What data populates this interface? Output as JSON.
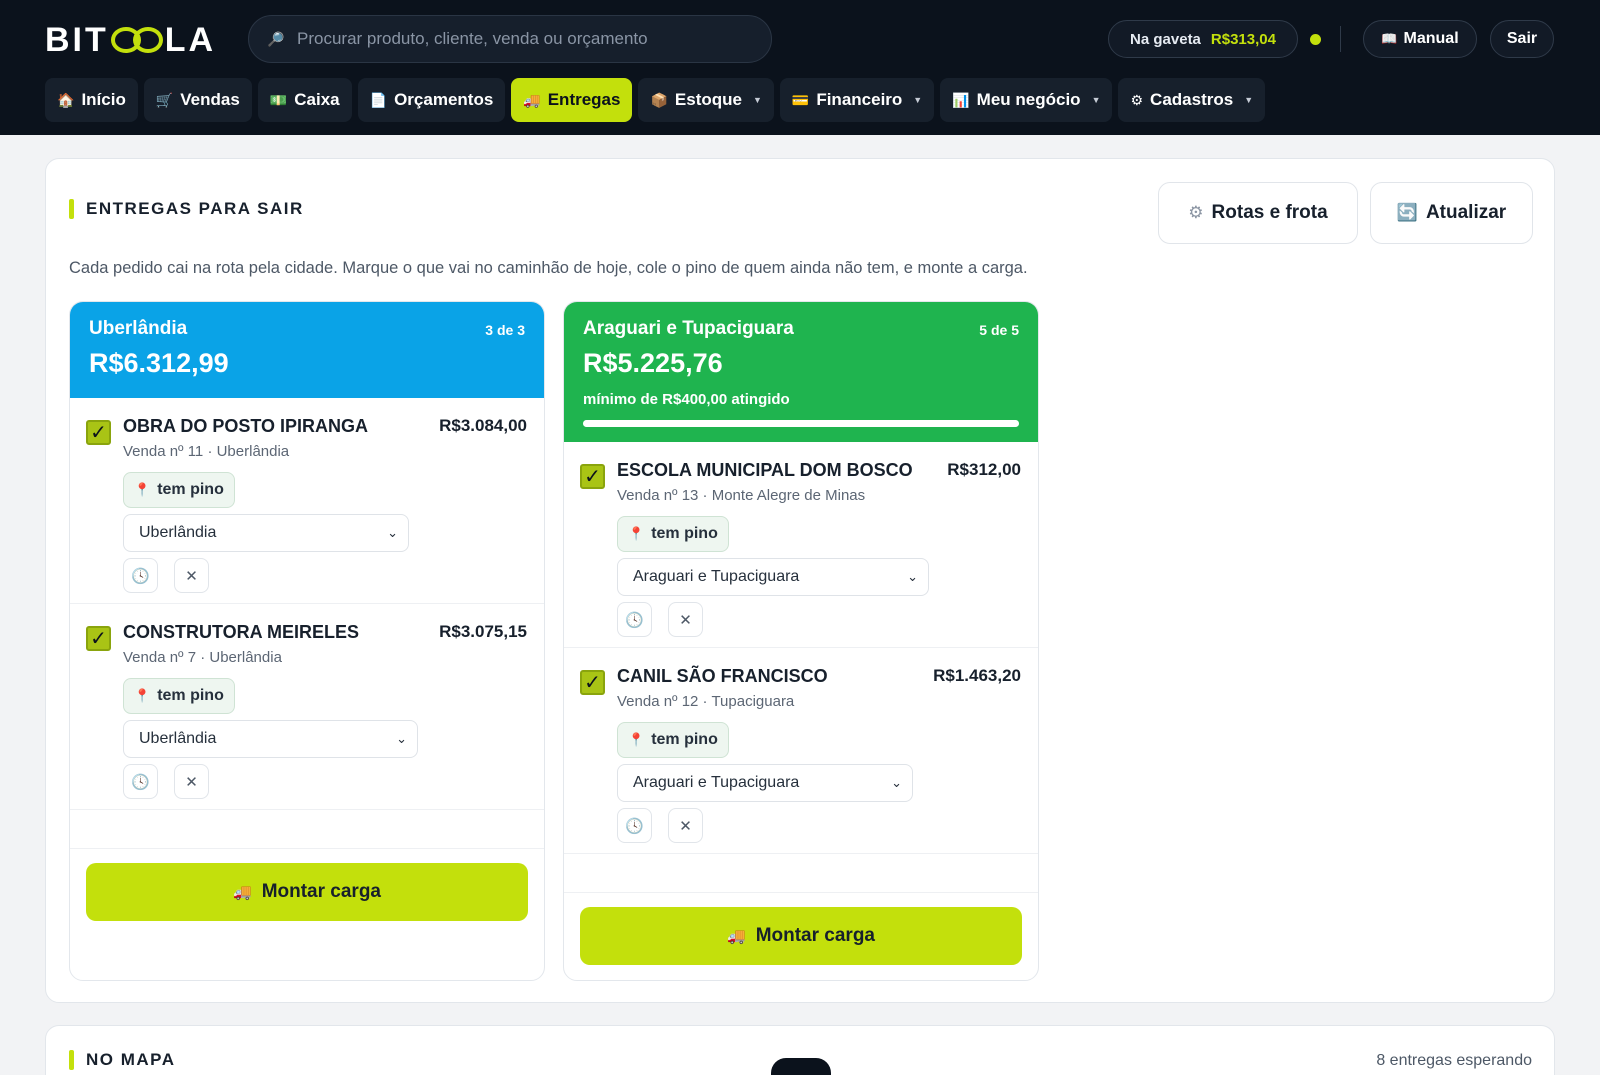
{
  "brand": {
    "prefix": "BIT",
    "suffix": "LA"
  },
  "search": {
    "placeholder": "Procurar produto, cliente, venda ou orçamento"
  },
  "header": {
    "drawer_label": "Na gaveta",
    "drawer_value": "R$313,04",
    "manual_label": "Manual",
    "logout_label": "Sair"
  },
  "nav": [
    {
      "label": "Início"
    },
    {
      "label": "Vendas"
    },
    {
      "label": "Caixa"
    },
    {
      "label": "Orçamentos"
    },
    {
      "label": "Entregas"
    },
    {
      "label": "Estoque"
    },
    {
      "label": "Financeiro"
    },
    {
      "label": "Meu negócio"
    },
    {
      "label": "Cadastros"
    }
  ],
  "main": {
    "title": "ENTREGAS PARA SAIR",
    "subtitle": "Cada pedido cai na rota pela cidade. Marque o que vai no caminhão de hoje, cole o pino de quem ainda não tem, e monte a carga.",
    "routes_button": "Rotas e frota",
    "refresh_button": "Atualizar"
  },
  "routes": [
    {
      "name": "Uberlândia",
      "count": "3 de 3",
      "total": "R$6.312,99",
      "header_color": "#0aa3e7",
      "load_button": "Montar carga",
      "orders": [
        {
          "name": "OBRA DO POSTO IPIRANGA",
          "value": "R$3.084,00",
          "meta": "Venda nº 11 · Uberlândia",
          "pin": "tem pino",
          "route": "Uberlândia",
          "checked": true
        },
        {
          "name": "CONSTRUTORA MEIRELES",
          "value": "R$3.075,15",
          "meta": "Venda nº 7 · Uberlândia",
          "pin": "tem pino",
          "route": "Uberlândia",
          "checked": true
        }
      ]
    },
    {
      "name": "Araguari e Tupaciguara",
      "count": "5 de 5",
      "total": "R$5.225,76",
      "minimum_note": "mínimo de R$400,00 atingido",
      "progress_fraction": 1.0,
      "header_color": "#1fb44f",
      "load_button": "Montar carga",
      "orders": [
        {
          "name": "ESCOLA MUNICIPAL DOM BOSCO",
          "value": "R$312,00",
          "meta": "Venda nº 13 · Monte Alegre de Minas",
          "pin": "tem pino",
          "route": "Araguari e Tupaciguara",
          "checked": true
        },
        {
          "name": "CANIL SÃO FRANCISCO",
          "value": "R$1.463,20",
          "meta": "Venda nº 12 · Tupaciguara",
          "pin": "tem pino",
          "route": "Araguari e Tupaciguara",
          "checked": true
        }
      ]
    }
  ],
  "map": {
    "title": "NO MAPA",
    "waiting": "8 entregas esperando"
  },
  "colors": {
    "accent": "#c3e00c",
    "dark": "#0b121c"
  }
}
